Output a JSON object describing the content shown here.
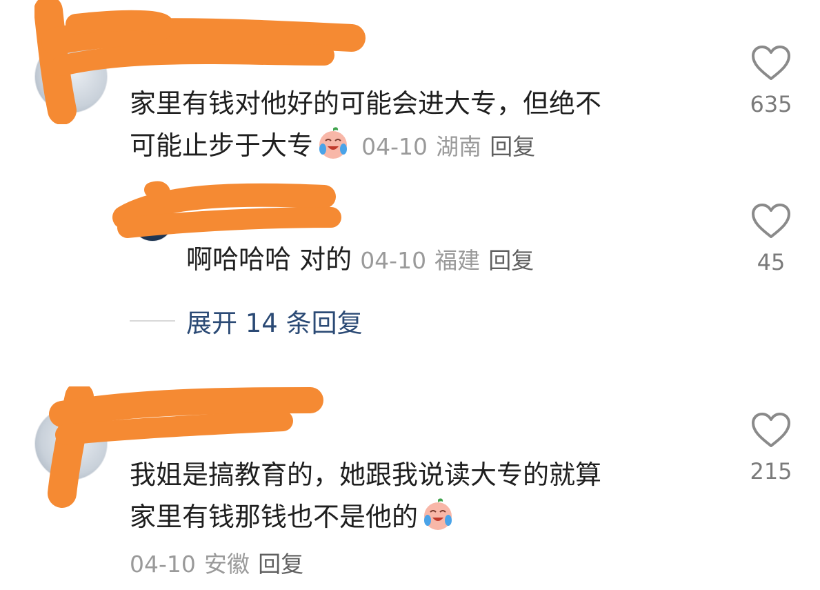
{
  "comments": [
    {
      "text": "家里有钱对他好的可能会进大专，但绝不可能止步于大专",
      "line1": "家里有钱对他好的可能会进大专，但绝不",
      "line2": "可能止步于大专",
      "emoji": "crying-laughing-peach",
      "date": "04-10",
      "location": "湖南",
      "reply_label": "回复",
      "likes": "635"
    },
    {
      "text": "啊哈哈哈 对的",
      "date": "04-10",
      "location": "福建",
      "reply_label": "回复",
      "likes": "45"
    },
    {
      "text": "我姐是搞教育的，她跟我说读大专的就算家里有钱那钱也不是他的",
      "line1": "我姐是搞教育的，她跟我说读大专的就算",
      "line2": "家里有钱那钱也不是他的",
      "emoji": "crying-laughing-peach",
      "date": "04-10",
      "location": "安徽",
      "reply_label": "回复",
      "likes": "215"
    }
  ],
  "expand_replies": {
    "label": "展开 14 条回复"
  },
  "icons": {
    "like": "heart-outline-icon"
  },
  "colors": {
    "redaction": "#f58a33",
    "expand_link": "#2b4a75",
    "meta": "#9a9a9a"
  }
}
